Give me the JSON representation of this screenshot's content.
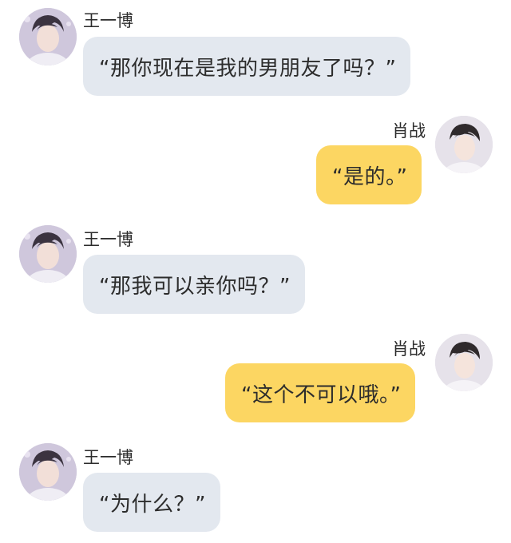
{
  "chat": {
    "messages": [
      {
        "sender": "王一博",
        "text": "“那你现在是我的男朋友了吗？”",
        "side": "left",
        "avatar": "avatar-wang"
      },
      {
        "sender": "肖战",
        "text": "“是的。”",
        "side": "right",
        "avatar": "avatar-xiao"
      },
      {
        "sender": "王一博",
        "text": "“那我可以亲你吗？”",
        "side": "left",
        "avatar": "avatar-wang"
      },
      {
        "sender": "肖战",
        "text": "“这个不可以哦。”",
        "side": "right",
        "avatar": "avatar-xiao"
      },
      {
        "sender": "王一博",
        "text": "“为什么？”",
        "side": "left",
        "avatar": "avatar-wang"
      }
    ]
  },
  "colors": {
    "left_bubble": "#e3e8ef",
    "right_bubble": "#fcd662",
    "background": "#ffffff"
  }
}
